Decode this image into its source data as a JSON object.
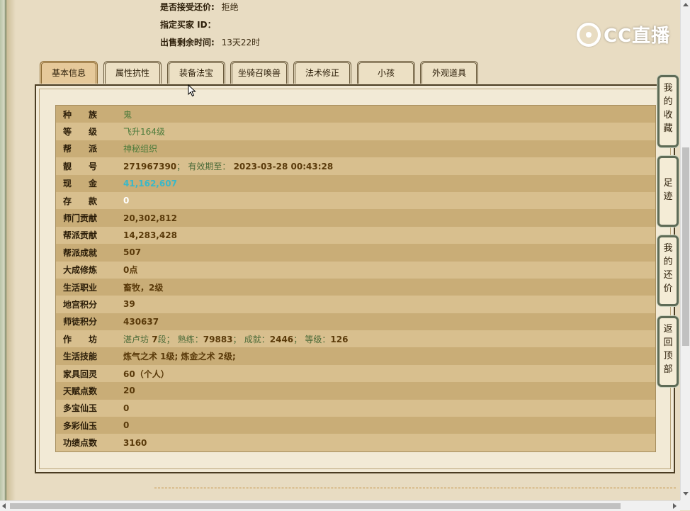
{
  "sale_info": {
    "accept_counter_label": "是否接受还价:",
    "accept_counter_value": "拒绝",
    "buyer_id_label": "指定买家 ID：",
    "buyer_id_value": "",
    "time_left_label": "出售剩余时间:",
    "time_left_value": "13天22时"
  },
  "logo": {
    "text": "CC直播"
  },
  "tabs": [
    {
      "label": "基本信息",
      "active": true
    },
    {
      "label": "属性抗性"
    },
    {
      "label": "装备法宝"
    },
    {
      "label": "坐骑召唤兽"
    },
    {
      "label": "法术修正"
    },
    {
      "label": "小孩"
    },
    {
      "label": "外观道具"
    }
  ],
  "info_rows": [
    {
      "label": "种　　族",
      "value": "鬼"
    },
    {
      "label": "等　　级",
      "value": "飞升164级"
    },
    {
      "label": "帮　　派",
      "value": "神秘组织"
    },
    {
      "label": "靓　　号",
      "value": "271967390",
      "sep": "；",
      "expire_label": "有效期至：",
      "expire_value": "2023-03-28 00:43:28"
    },
    {
      "label": "现　　金",
      "value": "41,162,607"
    },
    {
      "label": "存　　款",
      "value": "0"
    },
    {
      "label": "师门贡献",
      "value": "20,302,812"
    },
    {
      "label": "帮派贡献",
      "value": "14,283,428"
    },
    {
      "label": "帮派成就",
      "value": "507"
    },
    {
      "label": "大成修炼",
      "value": "0点"
    },
    {
      "label": "生活职业",
      "value": "畜牧，2级"
    },
    {
      "label": "地宫积分",
      "value": "39"
    },
    {
      "label": "师徒积分",
      "value": "430637"
    },
    {
      "label": "作　　坊",
      "workshop": {
        "name": "湛卢坊",
        "level": "7",
        "level_unit": "段；",
        "skill_label": "熟练：",
        "skill": "79883",
        "sep1": "；",
        "achieve_label": "成就：",
        "achieve": "2446",
        "sep2": "；",
        "grade_label": "等级：",
        "grade": "126"
      }
    },
    {
      "label": "生活技能",
      "value": "炼气之术 1级; 炼金之术 2级;"
    },
    {
      "label": "家具回灵",
      "value": "60（个人）"
    },
    {
      "label": "天赋点数",
      "value": "20"
    },
    {
      "label": "多宝仙玉",
      "value": "0"
    },
    {
      "label": "多彩仙玉",
      "value": "0"
    },
    {
      "label": "功绩点数",
      "value": "3160"
    }
  ],
  "side_buttons": [
    {
      "label": "我的收藏"
    },
    {
      "label": "足迹"
    },
    {
      "label": "我的还价"
    },
    {
      "label": "返回顶部"
    }
  ]
}
